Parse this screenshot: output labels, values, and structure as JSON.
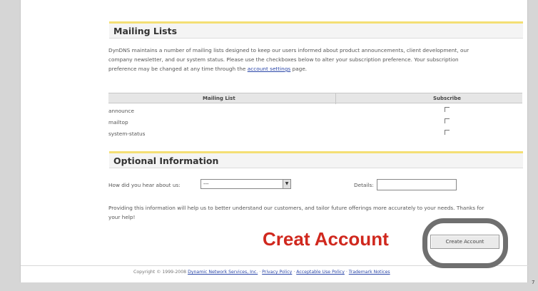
{
  "mailing_lists": {
    "title": "Mailing Lists",
    "description_1": "DynDNS maintains a number of mailing lists designed to keep our users informed about product announcements, client development, our",
    "description_2": "company newsletter, and our system status. Please use the checkboxes below to alter your subscription preference. Your subscription",
    "description_3": "preference may be changed at any time through the",
    "link": "account settings",
    "description_4": "page.",
    "col_list": "Mailing List",
    "col_subscribe": "Subscribe",
    "rows": [
      "announce",
      "mailtop",
      "system-status"
    ]
  },
  "optional": {
    "title": "Optional Information",
    "hear_label": "How did you hear about us:",
    "hear_value": "---",
    "details_label": "Details:",
    "note_1": "Providing this information will help us to better understand our customers, and tailor future offerings more accurately to your needs. Thanks for",
    "note_2": "your help!"
  },
  "annotation": "Creat Account",
  "create_button": "Create Account",
  "footer": {
    "copyright": "Copyright © 1999-2008",
    "company": "Dynamic Network Services, Inc.",
    "privacy": "Privacy Policy",
    "aup": "Acceptable Use Policy",
    "trademark": "Trademark Notices"
  },
  "side_mark": "7"
}
